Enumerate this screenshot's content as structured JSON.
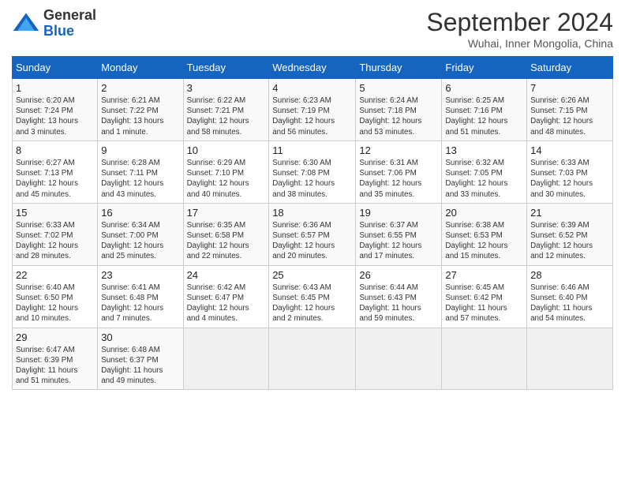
{
  "header": {
    "logo_line1": "General",
    "logo_line2": "Blue",
    "month": "September 2024",
    "location": "Wuhai, Inner Mongolia, China"
  },
  "weekdays": [
    "Sunday",
    "Monday",
    "Tuesday",
    "Wednesday",
    "Thursday",
    "Friday",
    "Saturday"
  ],
  "weeks": [
    [
      {
        "day": "1",
        "info": "Sunrise: 6:20 AM\nSunset: 7:24 PM\nDaylight: 13 hours\nand 3 minutes."
      },
      {
        "day": "2",
        "info": "Sunrise: 6:21 AM\nSunset: 7:22 PM\nDaylight: 13 hours\nand 1 minute."
      },
      {
        "day": "3",
        "info": "Sunrise: 6:22 AM\nSunset: 7:21 PM\nDaylight: 12 hours\nand 58 minutes."
      },
      {
        "day": "4",
        "info": "Sunrise: 6:23 AM\nSunset: 7:19 PM\nDaylight: 12 hours\nand 56 minutes."
      },
      {
        "day": "5",
        "info": "Sunrise: 6:24 AM\nSunset: 7:18 PM\nDaylight: 12 hours\nand 53 minutes."
      },
      {
        "day": "6",
        "info": "Sunrise: 6:25 AM\nSunset: 7:16 PM\nDaylight: 12 hours\nand 51 minutes."
      },
      {
        "day": "7",
        "info": "Sunrise: 6:26 AM\nSunset: 7:15 PM\nDaylight: 12 hours\nand 48 minutes."
      }
    ],
    [
      {
        "day": "8",
        "info": "Sunrise: 6:27 AM\nSunset: 7:13 PM\nDaylight: 12 hours\nand 45 minutes."
      },
      {
        "day": "9",
        "info": "Sunrise: 6:28 AM\nSunset: 7:11 PM\nDaylight: 12 hours\nand 43 minutes."
      },
      {
        "day": "10",
        "info": "Sunrise: 6:29 AM\nSunset: 7:10 PM\nDaylight: 12 hours\nand 40 minutes."
      },
      {
        "day": "11",
        "info": "Sunrise: 6:30 AM\nSunset: 7:08 PM\nDaylight: 12 hours\nand 38 minutes."
      },
      {
        "day": "12",
        "info": "Sunrise: 6:31 AM\nSunset: 7:06 PM\nDaylight: 12 hours\nand 35 minutes."
      },
      {
        "day": "13",
        "info": "Sunrise: 6:32 AM\nSunset: 7:05 PM\nDaylight: 12 hours\nand 33 minutes."
      },
      {
        "day": "14",
        "info": "Sunrise: 6:33 AM\nSunset: 7:03 PM\nDaylight: 12 hours\nand 30 minutes."
      }
    ],
    [
      {
        "day": "15",
        "info": "Sunrise: 6:33 AM\nSunset: 7:02 PM\nDaylight: 12 hours\nand 28 minutes."
      },
      {
        "day": "16",
        "info": "Sunrise: 6:34 AM\nSunset: 7:00 PM\nDaylight: 12 hours\nand 25 minutes."
      },
      {
        "day": "17",
        "info": "Sunrise: 6:35 AM\nSunset: 6:58 PM\nDaylight: 12 hours\nand 22 minutes."
      },
      {
        "day": "18",
        "info": "Sunrise: 6:36 AM\nSunset: 6:57 PM\nDaylight: 12 hours\nand 20 minutes."
      },
      {
        "day": "19",
        "info": "Sunrise: 6:37 AM\nSunset: 6:55 PM\nDaylight: 12 hours\nand 17 minutes."
      },
      {
        "day": "20",
        "info": "Sunrise: 6:38 AM\nSunset: 6:53 PM\nDaylight: 12 hours\nand 15 minutes."
      },
      {
        "day": "21",
        "info": "Sunrise: 6:39 AM\nSunset: 6:52 PM\nDaylight: 12 hours\nand 12 minutes."
      }
    ],
    [
      {
        "day": "22",
        "info": "Sunrise: 6:40 AM\nSunset: 6:50 PM\nDaylight: 12 hours\nand 10 minutes."
      },
      {
        "day": "23",
        "info": "Sunrise: 6:41 AM\nSunset: 6:48 PM\nDaylight: 12 hours\nand 7 minutes."
      },
      {
        "day": "24",
        "info": "Sunrise: 6:42 AM\nSunset: 6:47 PM\nDaylight: 12 hours\nand 4 minutes."
      },
      {
        "day": "25",
        "info": "Sunrise: 6:43 AM\nSunset: 6:45 PM\nDaylight: 12 hours\nand 2 minutes."
      },
      {
        "day": "26",
        "info": "Sunrise: 6:44 AM\nSunset: 6:43 PM\nDaylight: 11 hours\nand 59 minutes."
      },
      {
        "day": "27",
        "info": "Sunrise: 6:45 AM\nSunset: 6:42 PM\nDaylight: 11 hours\nand 57 minutes."
      },
      {
        "day": "28",
        "info": "Sunrise: 6:46 AM\nSunset: 6:40 PM\nDaylight: 11 hours\nand 54 minutes."
      }
    ],
    [
      {
        "day": "29",
        "info": "Sunrise: 6:47 AM\nSunset: 6:39 PM\nDaylight: 11 hours\nand 51 minutes."
      },
      {
        "day": "30",
        "info": "Sunrise: 6:48 AM\nSunset: 6:37 PM\nDaylight: 11 hours\nand 49 minutes."
      },
      {
        "day": "",
        "info": ""
      },
      {
        "day": "",
        "info": ""
      },
      {
        "day": "",
        "info": ""
      },
      {
        "day": "",
        "info": ""
      },
      {
        "day": "",
        "info": ""
      }
    ]
  ]
}
